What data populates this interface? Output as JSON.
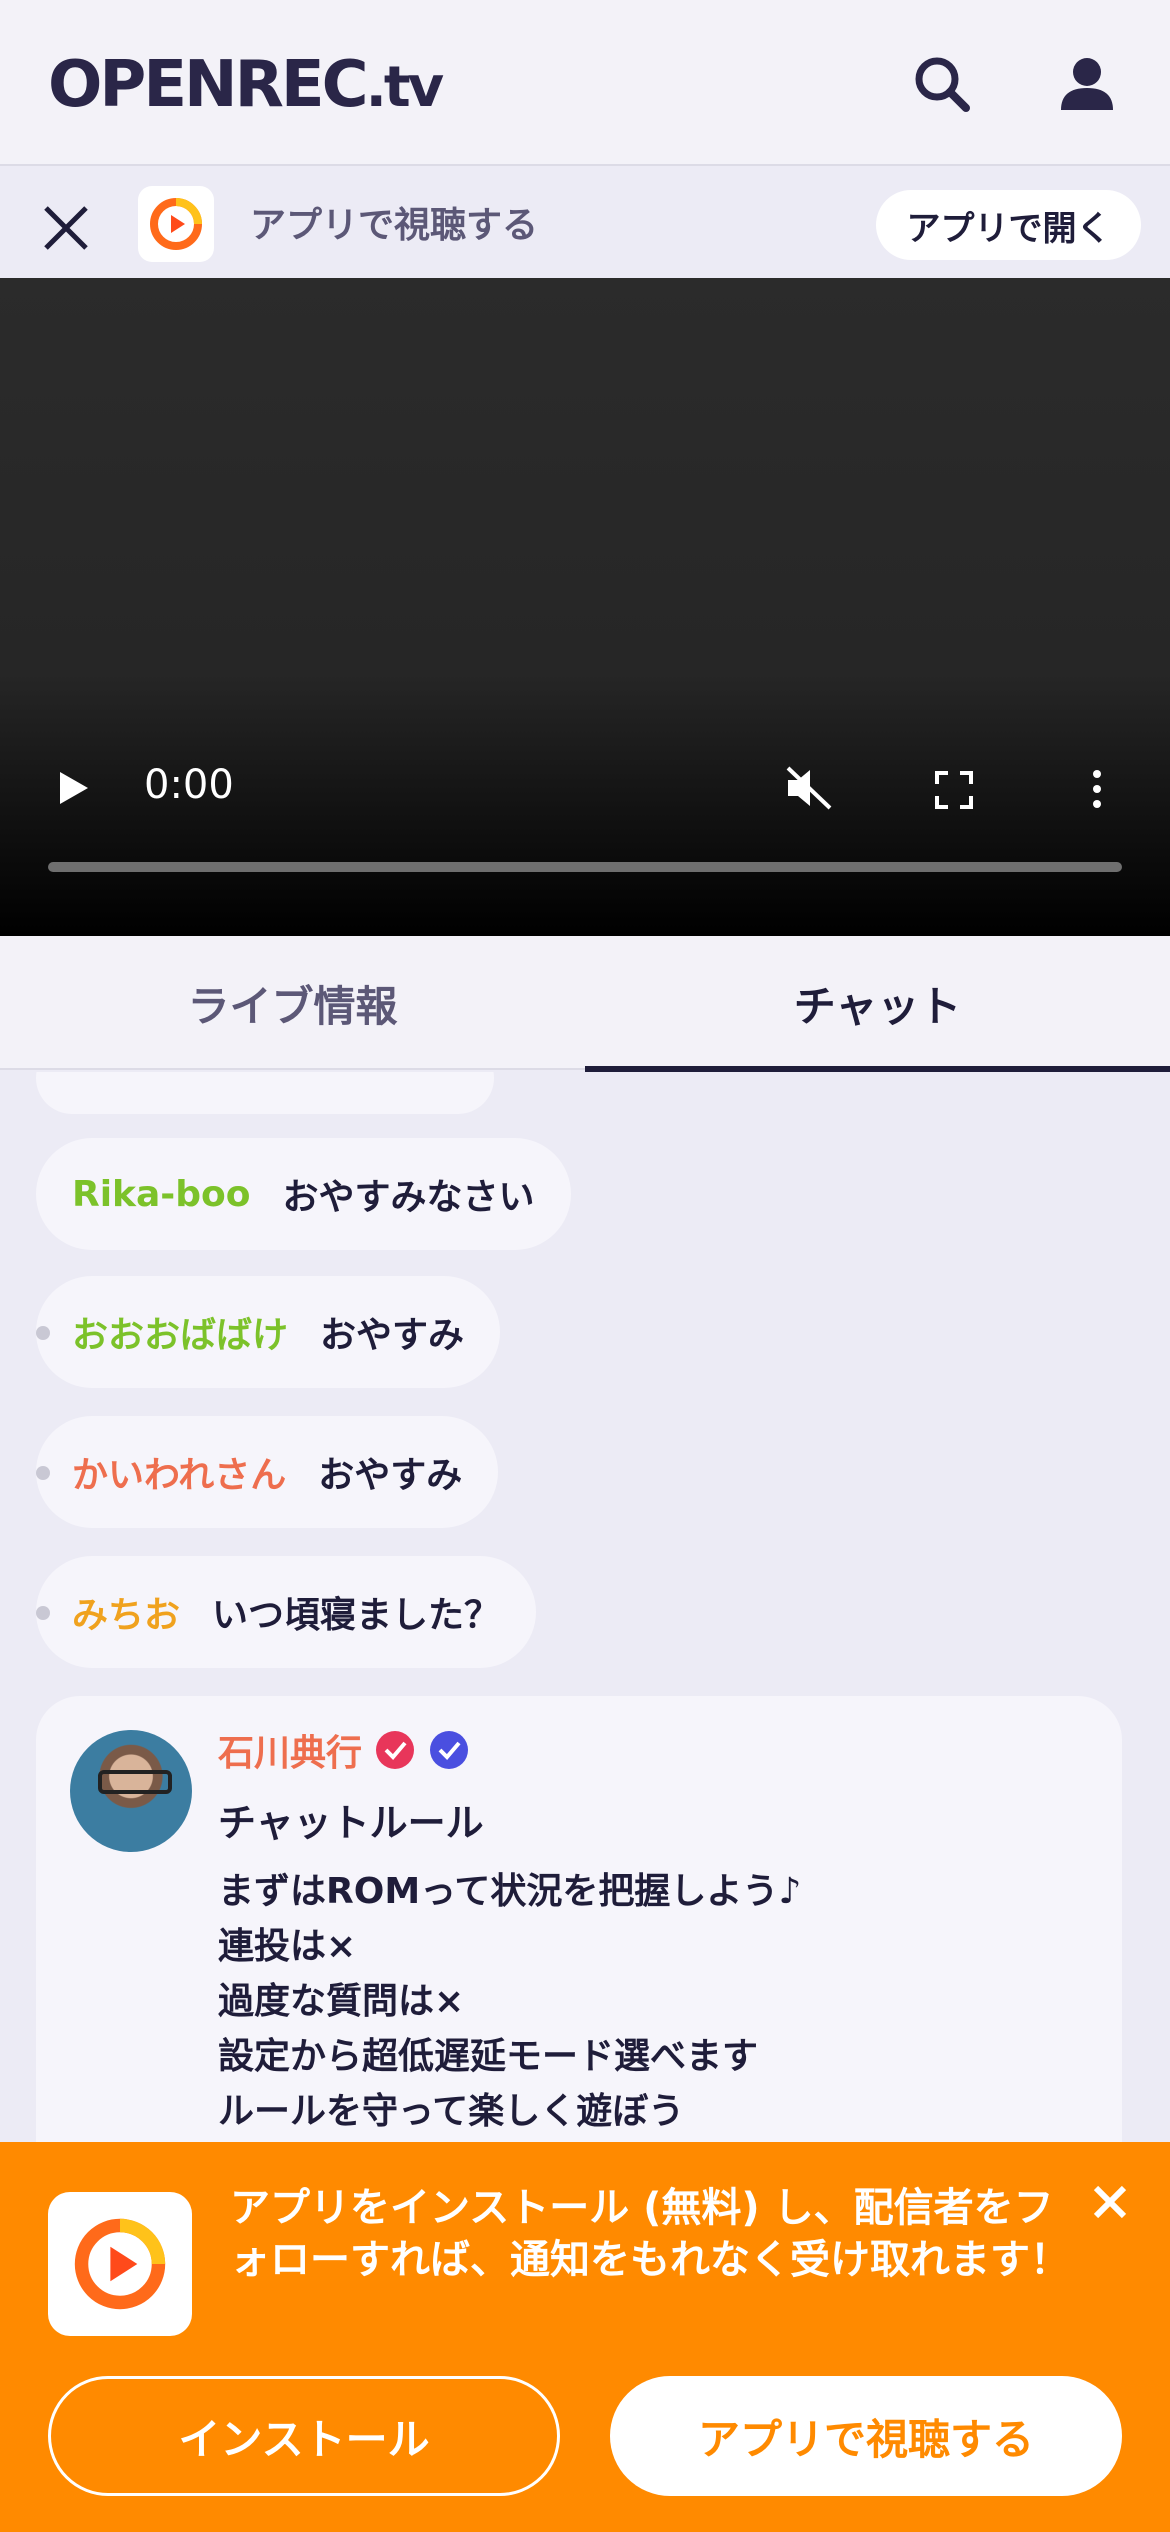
{
  "header": {
    "logo_main": "OPENREC",
    "logo_suffix": ".tv",
    "icons": [
      "search-icon",
      "user-icon"
    ]
  },
  "app_bar": {
    "text": "アプリで視聴する",
    "open_button": "アプリで開く"
  },
  "video": {
    "time": "0:00",
    "progress": 0,
    "muted": true
  },
  "tabs": [
    {
      "label": "ライブ情報",
      "active": false
    },
    {
      "label": "チャット",
      "active": true
    }
  ],
  "chat": {
    "messages": [
      {
        "name": "Rika-boo",
        "text": "おやすみなさい",
        "name_color": "#7cc22a"
      },
      {
        "name": "おおおばばけ",
        "text": "おやすみ",
        "name_color": "#7cc22a"
      },
      {
        "name": "かいわれさん",
        "text": "おやすみ",
        "name_color": "#ee6e4e"
      },
      {
        "name": "みちお",
        "text": "いつ頃寝ました？",
        "name_color": "#f0a21e"
      }
    ],
    "rules": {
      "author": "石川典行",
      "title": "チャットルール",
      "lines": [
        "まずはROMって状況を把握しよう♪",
        "連投は×",
        "過度な質問は×",
        "設定から超低遅延モード選べます",
        "ルールを守って楽しく遊ぼう"
      ]
    }
  },
  "banner": {
    "text": "アプリをインストール (無料) し、配信者をフォローすれば、通知をもれなく受け取れます！",
    "install_button": "インストール",
    "watch_button": "アプリで視聴する"
  },
  "colors": {
    "accent_orange": "#ff8a00",
    "text_dark": "#1f1d3a",
    "background": "#ecebf5"
  }
}
